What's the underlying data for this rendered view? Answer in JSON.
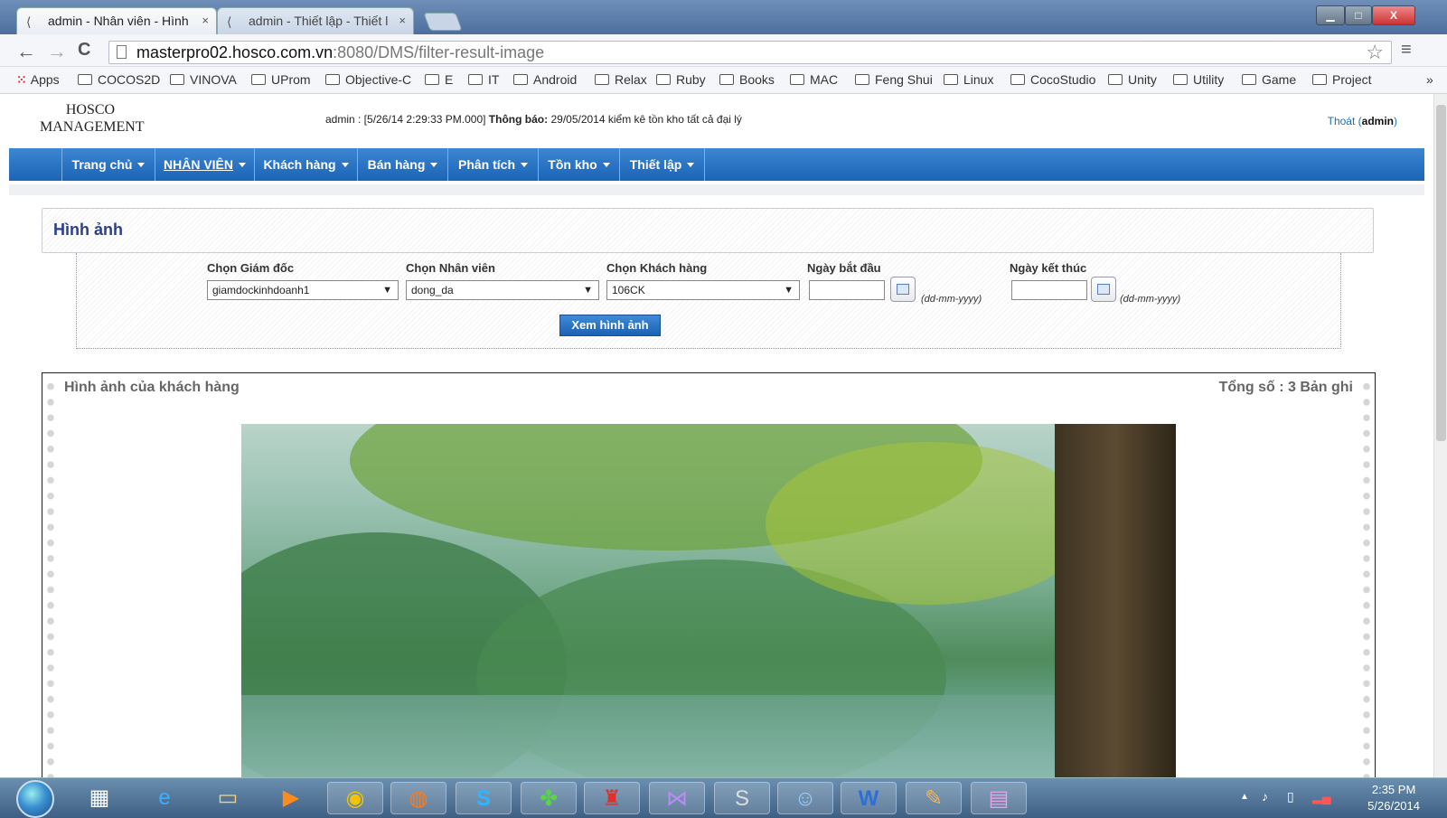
{
  "browser": {
    "tabs": [
      {
        "title": "admin - Nhân viên - Hình",
        "close": "×"
      },
      {
        "title": "admin - Thiết lập - Thiết l",
        "close": "×"
      }
    ],
    "window_buttons": {
      "minimize": "▁",
      "maximize": "□",
      "close": "X"
    },
    "nav": {
      "back": "←",
      "forward": "→",
      "reload": "C"
    },
    "url_host": "masterpro02.hosco.com.vn",
    "url_rest": ":8080/DMS/filter-result-image",
    "bookmarks": [
      "Apps",
      "COCOS2D",
      "VINOVA",
      "UProm",
      "Objective-C",
      "E",
      "IT",
      "Android",
      "Relax",
      "Ruby",
      "Books",
      "MAC",
      "Feng Shui",
      "Linux",
      "CocoStudio",
      "Unity",
      "Utility",
      "Game",
      "Project"
    ],
    "bookmarks_more": "»"
  },
  "header": {
    "logo_line1": "HOSCO",
    "logo_line2": "MANAGEMENT",
    "user_info": "admin : [5/26/14 2:29:33 PM.000]",
    "notice_label": "Thông báo:",
    "notice_text": "29/05/2014 kiểm kê tồn kho tất cả đại lý",
    "logout_label": "Thoát",
    "logout_user": "admin"
  },
  "menu": [
    {
      "label": "Trang chủ"
    },
    {
      "label": "NHÂN VIÊN"
    },
    {
      "label": "Khách hàng"
    },
    {
      "label": "Bán hàng"
    },
    {
      "label": "Phân tích"
    },
    {
      "label": "Tồn kho"
    },
    {
      "label": "Thiết lập"
    }
  ],
  "section_title": "Hình ảnh",
  "filter": {
    "director_label": "Chọn Giám đốc",
    "director_value": "giamdockinhdoanh1",
    "staff_label": "Chọn Nhân viên",
    "staff_value": "dong_da",
    "customer_label": "Chọn Khách hàng",
    "customer_value": "106CK",
    "start_label": "Ngày bắt đầu",
    "end_label": "Ngày kết thúc",
    "date_format": "(dd-mm-yyyy)",
    "submit_label": "Xem hình ảnh"
  },
  "results": {
    "title": "Hình ảnh của khách hàng",
    "count_label": "Tổng số : 3 Bản ghi"
  },
  "taskbar": {
    "time": "2:35 PM",
    "date": "5/26/2014",
    "tray_up": "▲"
  },
  "colors": {
    "menu_blue": "#1c64b4",
    "title_navy": "#2b3f8a",
    "link_blue": "#1f6fb0"
  }
}
